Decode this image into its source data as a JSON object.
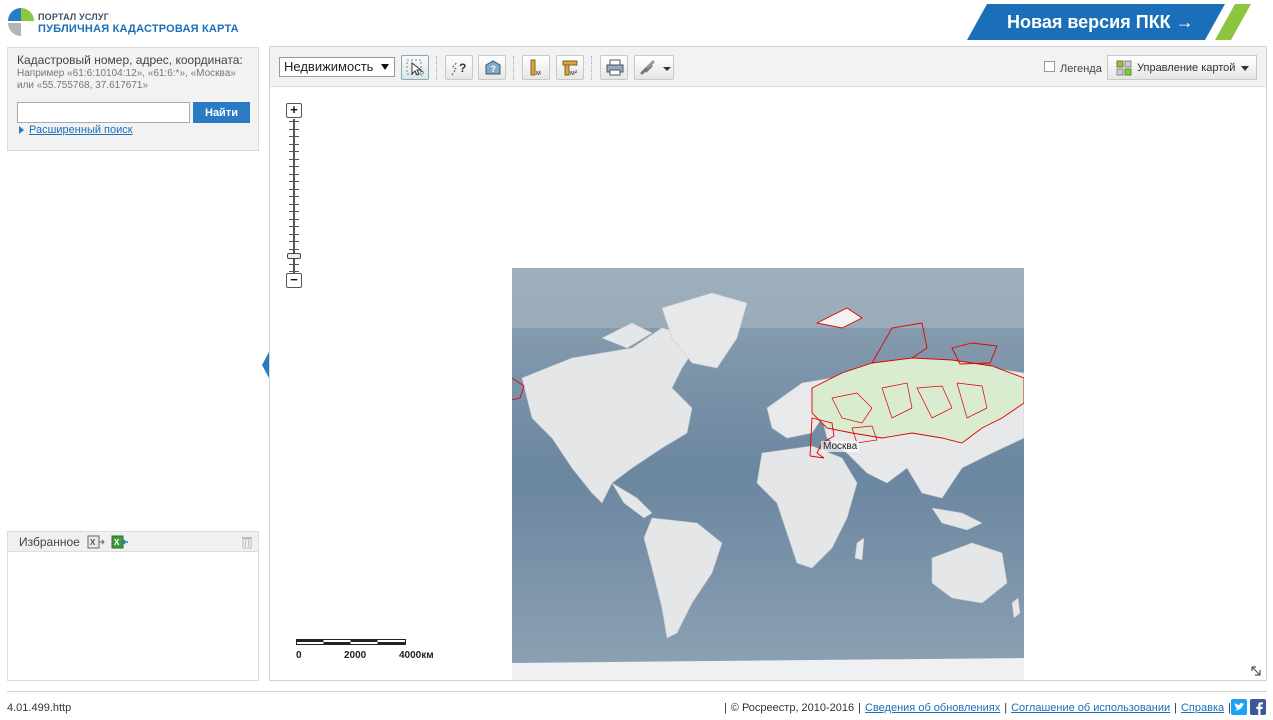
{
  "header": {
    "portal_small": "ПОРТАЛ УСЛУГ",
    "portal_big": "ПУБЛИЧНАЯ КАДАСТРОВАЯ КАРТА",
    "new_version_label": "Новая версия ПКК →",
    "colors": {
      "brand_blue": "#1a6fb8",
      "brand_green": "#8cc63f"
    }
  },
  "search": {
    "title": "Кадастровый номер, адрес, координата:",
    "hint": "Например «61:6:10104:12», «61:6:*», «Москва» или «55.755768, 37.617671»",
    "input_value": "",
    "button_label": "Найти",
    "advanced_link": "Расширенный поиск"
  },
  "favorites": {
    "title": "Избранное",
    "icons": [
      "export-excel-icon",
      "import-excel-icon",
      "trash-icon"
    ]
  },
  "toolbar": {
    "layer_select": "Недвижимость",
    "tools": [
      "select-info-icon",
      "identify-icon",
      "identify-object-icon",
      "measure-length-icon",
      "measure-area-icon",
      "print-icon",
      "link-icon"
    ],
    "legend_label": "Легенда",
    "map_control_label": "Управление картой"
  },
  "map": {
    "city_label": "Москва",
    "scale": {
      "labels": [
        "0",
        "2000",
        "4000км"
      ]
    },
    "zoom": {
      "level_fraction": 0.92
    }
  },
  "footer": {
    "version": "4.01.499.http",
    "copyright": "© Росреестр, 2010-2016",
    "links": [
      "Сведения об обновлениях",
      "Соглашение об использовании",
      "Справка"
    ],
    "social": [
      "twitter-icon",
      "facebook-icon"
    ]
  }
}
